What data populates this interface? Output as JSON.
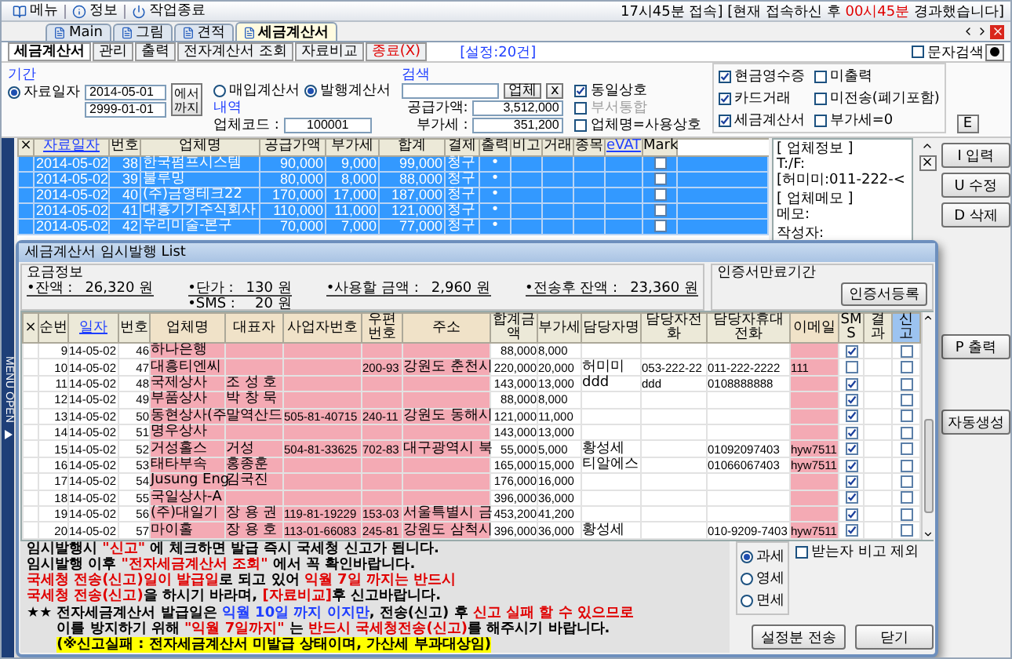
{
  "menubar": {
    "items": [
      {
        "label": "메뉴"
      },
      {
        "label": "정보"
      },
      {
        "label": "작업종료"
      }
    ],
    "status": [
      {
        "text": "17시45분 접속] [현재 접속하신 후 ",
        "kind": "plain"
      },
      {
        "text": "00시45분",
        "kind": "alert"
      },
      {
        "text": " 경과했습니다]",
        "kind": "plain"
      }
    ]
  },
  "tabs": [
    {
      "label": "Main",
      "selected": false
    },
    {
      "label": "그림",
      "selected": false
    },
    {
      "label": "견적",
      "selected": false
    },
    {
      "label": "세금계산서",
      "selected": true
    }
  ],
  "subtabs": [
    {
      "label": "세금계산서",
      "selected": true,
      "kind": "plain"
    },
    {
      "label": "관리",
      "selected": false,
      "kind": "plain"
    },
    {
      "label": "출력",
      "selected": false,
      "kind": "plain"
    },
    {
      "label": "전자계산서 조회",
      "selected": false,
      "kind": "plain"
    },
    {
      "label": "자료비교",
      "selected": false,
      "kind": "plain"
    },
    {
      "label": "종료(X)",
      "selected": false,
      "kind": "alert"
    }
  ],
  "setting_note": "[설정:20건]",
  "text_search": {
    "label": "문자검색",
    "checked": false
  },
  "period": {
    "title": "기간",
    "radio": {
      "label": "자료일자",
      "selected": true
    },
    "from": "2014-05-01",
    "to": "2999-01-01",
    "button": "에서 까지"
  },
  "invoice_types": [
    {
      "label": "매입계산서",
      "selected": false
    },
    {
      "label": "발행계산서",
      "selected": true
    }
  ],
  "detail": {
    "title": "내역",
    "code_label": "업체코드 :",
    "code": "100001"
  },
  "search": {
    "title": "검색",
    "buttons": [
      "업체",
      "x"
    ],
    "supply_label": "공급가액:",
    "supply": "3,512,000",
    "vat_label": "부가세 :",
    "vat": "351,200"
  },
  "search_options": [
    {
      "label": "동일상호",
      "checked": true,
      "disabled": false
    },
    {
      "label": "부서통합",
      "checked": false,
      "disabled": true
    },
    {
      "label": "업체명=사용상호",
      "checked": false,
      "disabled": false
    }
  ],
  "filters": [
    {
      "label": "현금영수증",
      "checked": true
    },
    {
      "label": "미출력",
      "checked": false
    },
    {
      "label": "카드거래",
      "checked": true
    },
    {
      "label": "미전송(폐기포함)",
      "checked": false
    },
    {
      "label": "세금계산서",
      "checked": true
    },
    {
      "label": "부가세=0",
      "checked": false
    }
  ],
  "e_button": "E",
  "menu_strip": {
    "label": "MENU OPEN"
  },
  "main_table": {
    "columns": [
      {
        "label": "×",
        "kind": "plain"
      },
      {
        "label": "자료일자",
        "kind": "link"
      },
      {
        "label": "번호",
        "kind": "plain"
      },
      {
        "label": "업체명",
        "kind": "plain"
      },
      {
        "label": "공급가액",
        "kind": "plain"
      },
      {
        "label": "부가세",
        "kind": "plain"
      },
      {
        "label": "합계",
        "kind": "plain"
      },
      {
        "label": "결제",
        "kind": "plain"
      },
      {
        "label": "출력",
        "kind": "plain"
      },
      {
        "label": "비고",
        "kind": "plain"
      },
      {
        "label": "거래",
        "kind": "plain"
      },
      {
        "label": "종목",
        "kind": "plain"
      },
      {
        "label": "eVAT",
        "kind": "link"
      },
      {
        "label": "Mark",
        "kind": "plain"
      }
    ],
    "rows": [
      {
        "date": "2014-05-02",
        "no": "38",
        "name": "한국펌프시스템",
        "supply": "90,000",
        "vat": "9,000",
        "total": "99,000",
        "payment": "청구",
        "output": "•",
        "mark": false,
        "selected": true
      },
      {
        "date": "2014-05-02",
        "no": "39",
        "name": "불루밍",
        "supply": "80,000",
        "vat": "8,000",
        "total": "88,000",
        "payment": "청구",
        "output": "•",
        "mark": false,
        "selected": true
      },
      {
        "date": "2014-05-02",
        "no": "40",
        "name": "(주)금영테크22",
        "supply": "170,000",
        "vat": "17,000",
        "total": "187,000",
        "payment": "청구",
        "output": "•",
        "mark": false,
        "selected": true
      },
      {
        "date": "2014-05-02",
        "no": "41",
        "name": "대흥기기주식회사",
        "supply": "110,000",
        "vat": "11,000",
        "total": "121,000",
        "payment": "청구",
        "output": "•",
        "mark": false,
        "selected": true
      },
      {
        "date": "2014-05-02",
        "no": "42",
        "name": "우리미술-본구",
        "supply": "70,000",
        "vat": "7,000",
        "total": "77,000",
        "payment": "청구",
        "output": "•",
        "mark": false,
        "selected": true
      }
    ]
  },
  "memo": {
    "sections": [
      [
        "[ 업체정보 ]",
        "T:/F:",
        "[허미미:011-222-<"
      ],
      [
        "[ 업체메모 ]",
        "메모:"
      ],
      [
        "작성자:"
      ]
    ],
    "close": "×"
  },
  "action_buttons": [
    [
      "I 입력",
      "U 수정",
      "D 삭제"
    ],
    [
      "P 출력"
    ],
    [
      "자동생성"
    ]
  ],
  "dialog": {
    "title": "세금계산서 임시발행 List",
    "fees": {
      "title": "요금정보",
      "columns": [
        [
          {
            "label": "•잔액 :",
            "value": "26,320 원"
          }
        ],
        [
          {
            "label": "•단가 :",
            "value": "130 원"
          },
          {
            "label": "•SMS :",
            "value": "20 원"
          }
        ],
        [
          {
            "label": "•사용할 금액 :",
            "value": "2,960 원"
          }
        ],
        [
          {
            "label": "•전송후 잔액 :",
            "value": "23,360 원"
          }
        ]
      ]
    },
    "cert": {
      "title": "인증서만료기간",
      "button": "인증서등록"
    },
    "table": {
      "columns": [
        {
          "label": "×",
          "kind": "plain"
        },
        {
          "label": "순번",
          "kind": "plain"
        },
        {
          "label": "일자",
          "kind": "link"
        },
        {
          "label": "번호",
          "kind": "plain"
        },
        {
          "label": "업체명",
          "kind": "required"
        },
        {
          "label": "대표자",
          "kind": "required"
        },
        {
          "label": "사업자번호",
          "kind": "required"
        },
        {
          "label": "우편번호",
          "kind": "required"
        },
        {
          "label": "주소",
          "kind": "required"
        },
        {
          "label": "합계금액",
          "kind": "plain"
        },
        {
          "label": "부가세",
          "kind": "plain"
        },
        {
          "label": "담당자명",
          "kind": "plain"
        },
        {
          "label": "담당자전화",
          "kind": "plain"
        },
        {
          "label": "담당자휴대전화",
          "kind": "plain"
        },
        {
          "label": "이메일",
          "kind": "required"
        },
        {
          "label": "SMS",
          "kind": "plain"
        },
        {
          "label": "결과",
          "kind": "plain"
        },
        {
          "label": "신고",
          "kind": "highlight"
        }
      ],
      "rows": [
        {
          "seq": "9",
          "date": "14-05-02",
          "no": "46",
          "name": "하나은행",
          "total": "88,000",
          "vat": "8,000",
          "sms": true,
          "report": false
        },
        {
          "seq": "10",
          "date": "14-05-02",
          "no": "47",
          "name": "대흥티엔씨",
          "zip": "200-93",
          "address": "강원도 춘천시",
          "total": "220,000",
          "vat": "20,000",
          "contact": "허미미",
          "phone": "053-222-22",
          "mobile": "011-222-2222",
          "email": "111",
          "sms": false,
          "report": false
        },
        {
          "seq": "11",
          "date": "14-05-02",
          "no": "48",
          "name": "국제상사",
          "ceo": "조 성 호",
          "total": "143,000",
          "vat": "13,000",
          "contact": "ddd",
          "phone": "ddd",
          "mobile": "0108888888",
          "sms": true,
          "report": false
        },
        {
          "seq": "12",
          "date": "14-05-02",
          "no": "49",
          "name": "부품상사",
          "ceo": "박 창 묵",
          "total": "88,000",
          "vat": "8,000",
          "sms": true,
          "report": false
        },
        {
          "seq": "13",
          "date": "14-05-02",
          "no": "50",
          "name": "동현상사(주",
          "ceo": "말역산드",
          "biz_no": "505-81-40715",
          "zip": "240-11",
          "address": "강원도 동해시",
          "total": "121,000",
          "vat": "11,000",
          "sms": true,
          "report": false
        },
        {
          "seq": "14",
          "date": "14-05-02",
          "no": "51",
          "name": "명우상사",
          "total": "143,000",
          "vat": "13,000",
          "sms": true,
          "report": false
        },
        {
          "seq": "15",
          "date": "14-05-02",
          "no": "52",
          "name": "거성홀스",
          "ceo": "거성",
          "biz_no": "504-81-33625",
          "zip": "702-83",
          "address": "대구광역시 북",
          "total": "55,000",
          "vat": "5,000",
          "contact": "황성세",
          "mobile": "01092097403",
          "email": "hyw7511",
          "sms": true,
          "report": false
        },
        {
          "seq": "16",
          "date": "14-05-02",
          "no": "53",
          "name": "태타부속",
          "ceo": "홍종훈",
          "total": "165,000",
          "vat": "15,000",
          "contact": "티알에스",
          "mobile": "01066067403",
          "email": "hyw7511",
          "sms": true,
          "report": false
        },
        {
          "seq": "17",
          "date": "14-05-02",
          "no": "54",
          "name": "Jusung Eng",
          "ceo": "김국진",
          "total": "176,000",
          "vat": "16,000",
          "sms": true,
          "report": false
        },
        {
          "seq": "18",
          "date": "14-05-02",
          "no": "55",
          "name": "국일상사-A",
          "total": "396,000",
          "vat": "36,000",
          "sms": true,
          "report": false
        },
        {
          "seq": "19",
          "date": "14-05-02",
          "no": "56",
          "name": "(주)대일기",
          "ceo": "장 용 권",
          "biz_no": "119-81-19229",
          "zip": "153-03",
          "address": "서울특별시 금",
          "total": "453,200",
          "vat": "41,200",
          "sms": true,
          "report": false
        },
        {
          "seq": "20",
          "date": "14-05-02",
          "no": "57",
          "name": "마이홀",
          "ceo": "장 용 호",
          "biz_no": "113-01-66083",
          "zip": "245-81",
          "address": "강원도 삼척시",
          "total": "396,000",
          "vat": "36,000",
          "contact": "황성세",
          "mobile": "010-9209-7403",
          "email": "hyw7511",
          "sms": true,
          "report": false
        }
      ]
    },
    "notice": {
      "lines": [
        [
          {
            "text": "임시발행시 ",
            "kind": "plain"
          },
          {
            "text": "\"신고\"",
            "kind": "alert"
          },
          {
            "text": " 에 체크하면 발급 즉시 국세청 신고가 됩니다.",
            "kind": "plain"
          }
        ],
        [
          {
            "text": "임시발행 이후 ",
            "kind": "plain"
          },
          {
            "text": "\"전자세금계산서 조회\"",
            "kind": "alert"
          },
          {
            "text": " 에서 꼭 확인바랍니다.",
            "kind": "plain"
          }
        ],
        [
          {
            "text": "국세청 전송(신고)일이 발급일",
            "kind": "alert"
          },
          {
            "text": "로 되고 있어 ",
            "kind": "plain"
          },
          {
            "text": "익월  7일 까지는 반드시",
            "kind": "alert"
          }
        ],
        [
          {
            "text": " 국세청 전송(신고)",
            "kind": "alert"
          },
          {
            "text": "을 하시기 바라며, ",
            "kind": "plain"
          },
          {
            "text": "[자료비교]",
            "kind": "alert"
          },
          {
            "text": "후 신고바랍니다.",
            "kind": "plain"
          }
        ]
      ],
      "mark": "★★",
      "marked_lines": [
        [
          {
            "text": "전자세금계산서 발급일은 ",
            "kind": "plain"
          },
          {
            "text": "익월 10일 까지 이지만",
            "kind": "emphasis"
          },
          {
            "text": ", 전송(신고) 후 ",
            "kind": "plain"
          },
          {
            "text": "신고 실패 할 수 있으므로",
            "kind": "alert"
          }
        ],
        [
          {
            "text": "이를 방지하기 위해 ",
            "kind": "plain"
          },
          {
            "text": "\"익월 7일까지\"",
            "kind": "alert"
          },
          {
            "text": " 는 ",
            "kind": "plain"
          },
          {
            "text": "반드시 국세청전송(신고)",
            "kind": "alert"
          },
          {
            "text": "를 해주시기 바랍니다.",
            "kind": "plain"
          }
        ],
        [
          {
            "text": "(※신고실패 : 전자세금계산서 미발급 상태이며, 가산세 부과대상임)",
            "kind": "highlight"
          }
        ]
      ]
    },
    "tax_types": [
      {
        "label": "과세",
        "selected": true
      },
      {
        "label": "영세",
        "selected": false
      },
      {
        "label": "면세",
        "selected": false
      }
    ],
    "exclude_remark": {
      "label": "받는자 비고 제외",
      "checked": false
    },
    "buttons": [
      "설정분 전송",
      "닫기"
    ]
  }
}
